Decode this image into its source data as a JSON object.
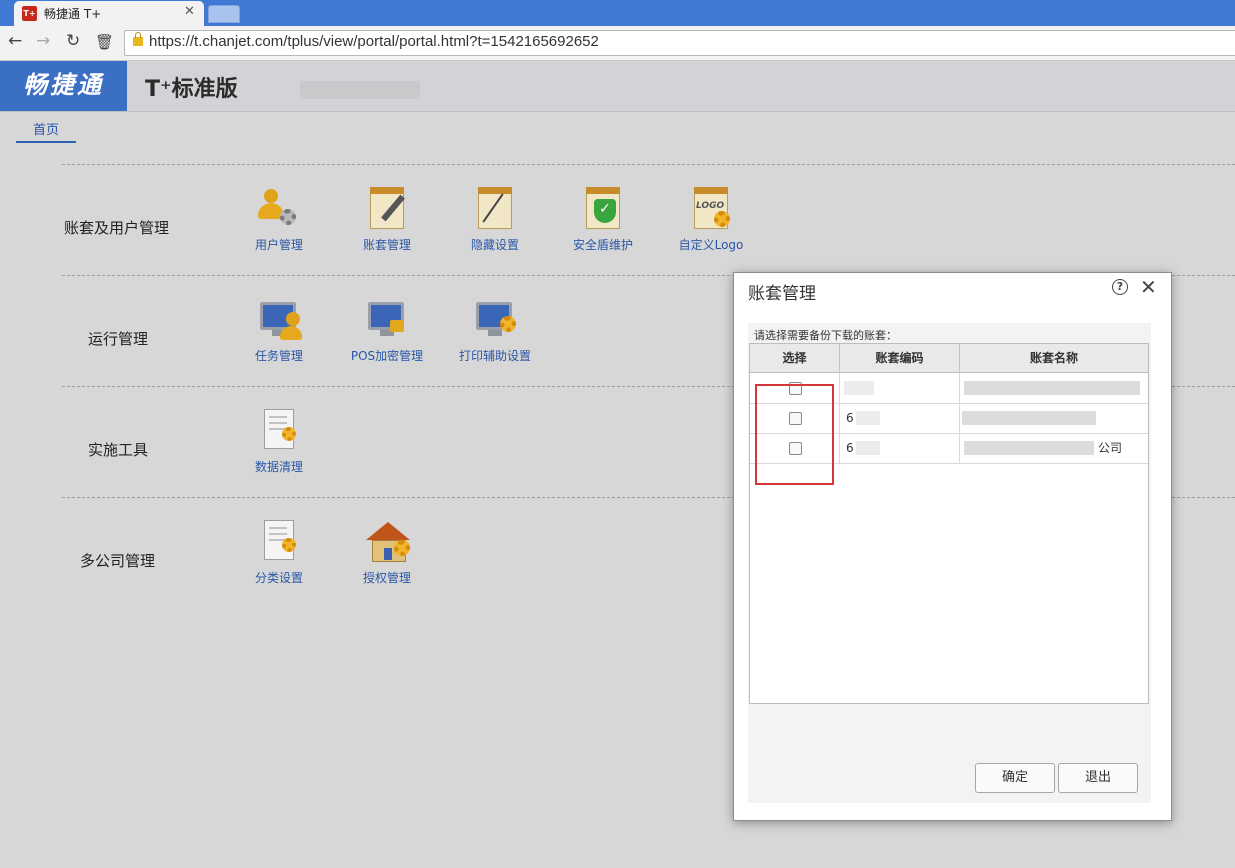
{
  "browser": {
    "tab_title": "畅捷通 T+",
    "favicon_text": "T+",
    "url": "https://t.chanjet.com/tplus/view/portal/portal.html?t=1542165692652"
  },
  "header": {
    "logo_text": "畅捷通",
    "product_name": "T⁺标准版"
  },
  "nav": {
    "home_tab": "首页"
  },
  "sections": [
    {
      "title": "账套及用户管理",
      "items": [
        "用户管理",
        "账套管理",
        "隐藏设置",
        "安全盾维护",
        "自定义Logo"
      ]
    },
    {
      "title": "运行管理",
      "items": [
        "任务管理",
        "POS加密管理",
        "打印辅助设置"
      ]
    },
    {
      "title": "实施工具",
      "items": [
        "数据清理"
      ]
    },
    {
      "title": "多公司管理",
      "items": [
        "分类设置",
        "授权管理"
      ]
    }
  ],
  "dialog": {
    "title": "账套管理",
    "prompt": "请选择需要备份下载的账套：",
    "columns": [
      "选择",
      "账套编码",
      "账套名称"
    ],
    "rows": [
      {
        "code": "",
        "name": ""
      },
      {
        "code": "6",
        "name": ""
      },
      {
        "code": "6",
        "name": "公司"
      }
    ],
    "ok_label": "确定",
    "exit_label": "退出"
  },
  "colors": {
    "brand_blue": "#3a6fc4",
    "link_blue": "#2a57a8",
    "highlight_red": "#d6363a"
  }
}
